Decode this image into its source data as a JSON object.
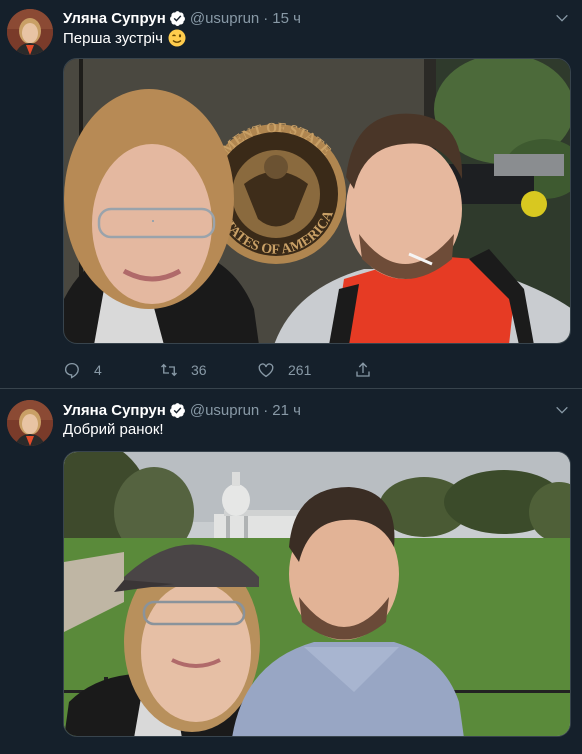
{
  "tweets": [
    {
      "author_name": "Уляна Супрун",
      "handle": "@usuprun",
      "separator": "·",
      "time": "15 ч",
      "text": "Перша зустріч",
      "emoji": "winking-face",
      "replies": "4",
      "retweets": "36",
      "likes": "261"
    },
    {
      "author_name": "Уляна Супрун",
      "handle": "@usuprun",
      "separator": "·",
      "time": "21 ч",
      "text": "Добрий ранок!"
    }
  ],
  "seal_text": {
    "top": "RTMENT OF STATE",
    "bottom": "TATES OF AMERICA"
  },
  "colors": {
    "background": "#15202b",
    "border": "#38444d",
    "secondary_text": "#8899a6",
    "verified": "#1da1f2"
  },
  "icons": [
    "verified-badge-icon",
    "chevron-down-icon",
    "reply-icon",
    "retweet-icon",
    "like-icon",
    "share-icon"
  ]
}
